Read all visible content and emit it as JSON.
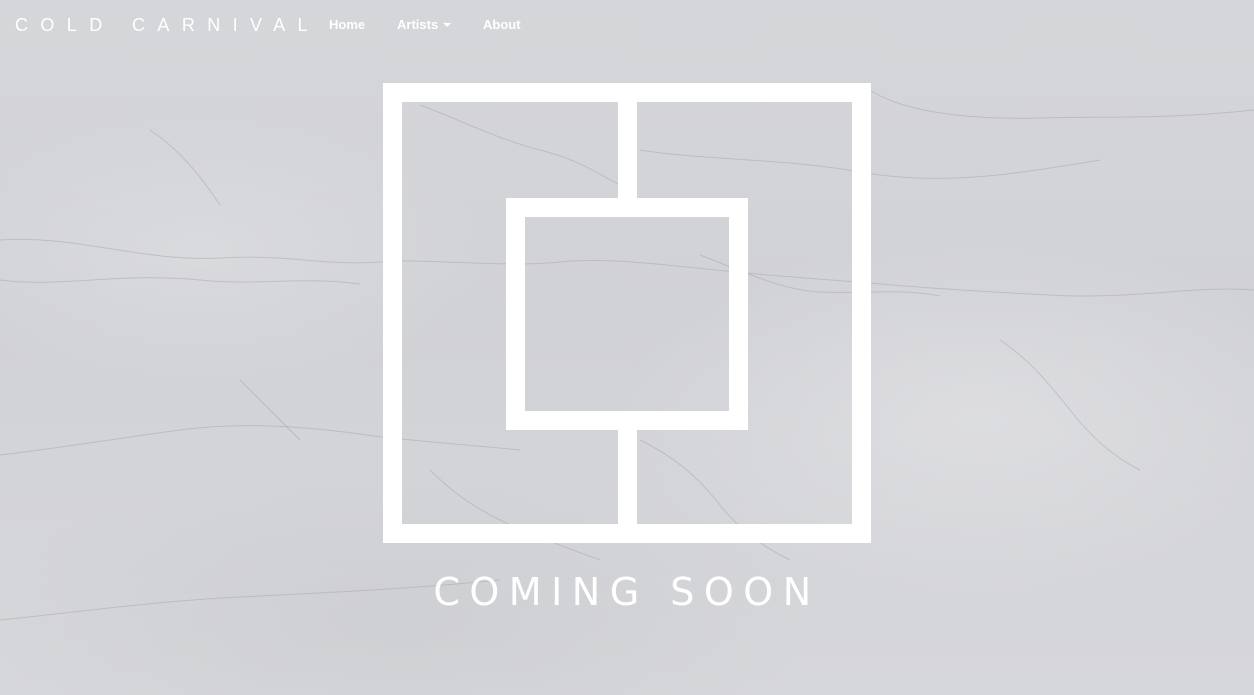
{
  "nav": {
    "brand": "COLD CARNIVAL",
    "links": {
      "home": "Home",
      "artists": "Artists",
      "about": "About"
    }
  },
  "hero": {
    "headline": "COMING SOON"
  },
  "colors": {
    "text": "#ffffff",
    "background": "#d4d5d8"
  },
  "icons": {
    "artists_dropdown": "caret-down-icon",
    "logo": "nested-squares-logo"
  }
}
